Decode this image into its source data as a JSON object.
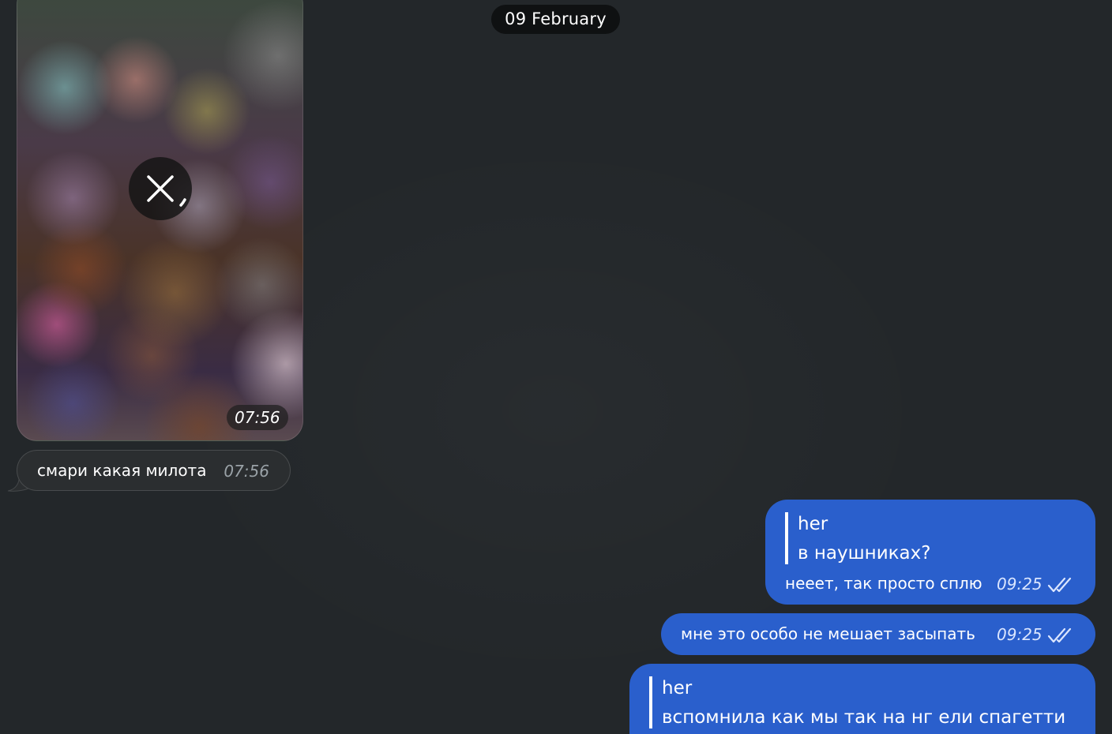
{
  "date_separator": "09 February",
  "messages": [
    {
      "type": "media",
      "direction": "incoming",
      "time": "07:56",
      "overlay_icon": "close-icon"
    },
    {
      "type": "text",
      "direction": "incoming",
      "text": "смари какая милота",
      "time": "07:56"
    },
    {
      "type": "text",
      "direction": "outgoing",
      "reply_to": {
        "name": "her",
        "text": "в наушниках?"
      },
      "text": "нееет, так просто сплю",
      "time": "09:25",
      "status_icon": "double-check-icon"
    },
    {
      "type": "text",
      "direction": "outgoing",
      "text": "мне это особо не мешает засыпать",
      "time": "09:25",
      "status_icon": "double-check-icon"
    },
    {
      "type": "text",
      "direction": "outgoing",
      "reply_to": {
        "name": "her",
        "text": "вспомнила как мы так на нг ели спагетти"
      }
    }
  ],
  "colors": {
    "background": "#23272a",
    "outgoing_bubble": "#2a5fcc",
    "incoming_bubble": "#2b2e30",
    "date_pill": "#0f1112"
  }
}
